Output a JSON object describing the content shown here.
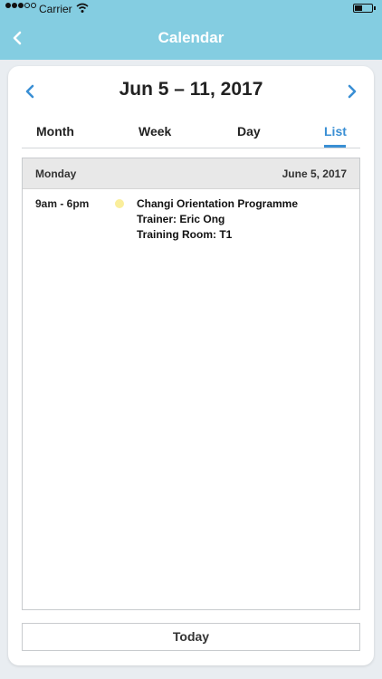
{
  "status_bar": {
    "carrier": "Carrier"
  },
  "header": {
    "title": "Calendar"
  },
  "calendar": {
    "range_title": "Jun 5 – 11, 2017",
    "tabs": [
      {
        "label": "Month",
        "active": false
      },
      {
        "label": "Week",
        "active": false
      },
      {
        "label": "Day",
        "active": false
      },
      {
        "label": "List",
        "active": true
      }
    ],
    "day": {
      "name": "Monday",
      "date": "June 5, 2017",
      "events": [
        {
          "time": "9am - 6pm",
          "title": "Changi Orientation Programme",
          "trainer": "Trainer: Eric Ong",
          "room": "Training Room: T1",
          "dot_color": "#faee9b"
        }
      ]
    },
    "today_label": "Today"
  },
  "colors": {
    "accent": "#3a8fd4",
    "header_bg": "#84cde1"
  }
}
